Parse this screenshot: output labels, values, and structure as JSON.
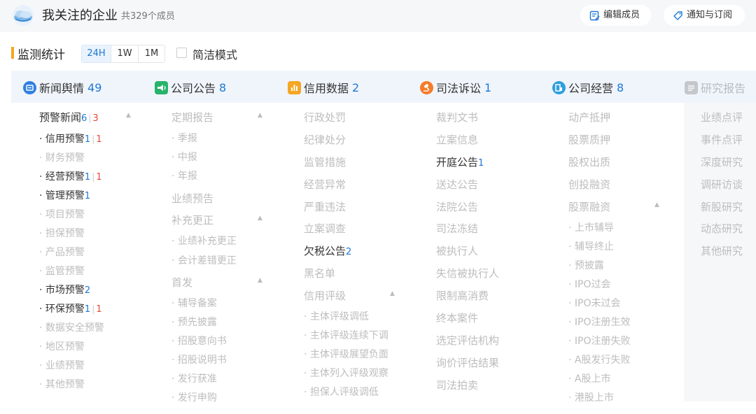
{
  "header": {
    "title": "我关注的企业",
    "member_count": "共329个成员",
    "edit_button": "编辑成员",
    "notify_button": "通知与订阅"
  },
  "monitor": {
    "title": "监测统计",
    "ranges": [
      "24H",
      "1W",
      "1M"
    ],
    "active_range": "24H",
    "simple_mode_label": "简洁模式",
    "simple_mode_checked": false
  },
  "tabs": [
    {
      "label": "新闻舆情",
      "count": "49",
      "icon": "news-icon",
      "color": "#2f7fe0"
    },
    {
      "label": "公司公告",
      "count": "8",
      "icon": "announcement-icon",
      "color": "#27b36b"
    },
    {
      "label": "信用数据",
      "count": "2",
      "icon": "bar-chart-icon",
      "color": "#f5a623"
    },
    {
      "label": "司法诉讼",
      "count": "1",
      "icon": "gavel-icon",
      "color": "#f57c2a"
    },
    {
      "label": "公司经营",
      "count": "8",
      "icon": "business-icon",
      "color": "#2f9fe0"
    },
    {
      "label": "研究报告",
      "count": "",
      "icon": "report-icon",
      "color": "#c4c7cc"
    }
  ],
  "columns": {
    "news": {
      "header": {
        "label": "预警新闻",
        "count_blue": "6",
        "count_red": "3"
      },
      "items": [
        {
          "label": "· 信用预警",
          "blue": "1",
          "red": "1",
          "active": true
        },
        {
          "label": "· 财务预警",
          "blue": "",
          "red": "",
          "active": false
        },
        {
          "label": "· 经营预警",
          "blue": "1",
          "red": "1",
          "active": true
        },
        {
          "label": "· 管理预警",
          "blue": "1",
          "red": "",
          "active": true
        },
        {
          "label": "· 项目预警",
          "blue": "",
          "red": "",
          "active": false
        },
        {
          "label": "· 担保预警",
          "blue": "",
          "red": "",
          "active": false
        },
        {
          "label": "· 产品预警",
          "blue": "",
          "red": "",
          "active": false
        },
        {
          "label": "· 监管预警",
          "blue": "",
          "red": "",
          "active": false
        },
        {
          "label": "· 市场预警",
          "blue": "2",
          "red": "",
          "active": true
        },
        {
          "label": "· 环保预警",
          "blue": "1",
          "red": "1",
          "active": true
        },
        {
          "label": "· 数据安全预警",
          "blue": "",
          "red": "",
          "active": false
        },
        {
          "label": "· 地区预警",
          "blue": "",
          "red": "",
          "active": false
        },
        {
          "label": "· 业绩预警",
          "blue": "",
          "red": "",
          "active": false
        },
        {
          "label": "· 其他预警",
          "blue": "",
          "red": "",
          "active": false
        }
      ]
    },
    "announcements": {
      "groups": [
        {
          "label": "定期报告",
          "items": [
            "· 季报",
            "· 中报",
            "· 年报"
          ]
        },
        {
          "label": "业绩预告",
          "items": []
        },
        {
          "label": "补充更正",
          "items": [
            "· 业绩补充更正",
            "· 会计差错更正"
          ]
        },
        {
          "label": "首发",
          "items": [
            "· 辅导备案",
            "· 预先披露",
            "· 招股意向书",
            "· 招股说明书",
            "· 发行获准",
            "· 发行申购"
          ]
        }
      ]
    },
    "credit": {
      "items": [
        {
          "label": "行政处罚",
          "count": "",
          "active": false
        },
        {
          "label": "纪律处分",
          "count": "",
          "active": false
        },
        {
          "label": "监管措施",
          "count": "",
          "active": false
        },
        {
          "label": "经营异常",
          "count": "",
          "active": false
        },
        {
          "label": "严重违法",
          "count": "",
          "active": false
        },
        {
          "label": "立案调查",
          "count": "",
          "active": false
        },
        {
          "label": "欠税公告",
          "count": "2",
          "active": true
        },
        {
          "label": "黑名单",
          "count": "",
          "active": false
        },
        {
          "label": "信用评级",
          "count": "",
          "active": false
        }
      ],
      "rating_items": [
        "· 主体评级调低",
        "· 主体评级连续下调",
        "· 主体评级展望负面",
        "· 主体列入评级观察",
        "· 担保人评级调低"
      ]
    },
    "judicial": {
      "items": [
        {
          "label": "裁判文书",
          "count": "",
          "active": false
        },
        {
          "label": "立案信息",
          "count": "",
          "active": false
        },
        {
          "label": "开庭公告",
          "count": "1",
          "active": true
        },
        {
          "label": "送达公告",
          "count": "",
          "active": false
        },
        {
          "label": "法院公告",
          "count": "",
          "active": false
        },
        {
          "label": "司法冻结",
          "count": "",
          "active": false
        },
        {
          "label": "被执行人",
          "count": "",
          "active": false
        },
        {
          "label": "失信被执行人",
          "count": "",
          "active": false
        },
        {
          "label": "限制高消费",
          "count": "",
          "active": false
        },
        {
          "label": "终本案件",
          "count": "",
          "active": false
        },
        {
          "label": "选定评估机构",
          "count": "",
          "active": false
        },
        {
          "label": "询价评估结果",
          "count": "",
          "active": false
        },
        {
          "label": "司法拍卖",
          "count": "",
          "active": false
        }
      ]
    },
    "operations": {
      "items": [
        "动产抵押",
        "股票质押",
        "股权出质",
        "创投融资",
        "股票融资"
      ],
      "financing_items": [
        "· 上市辅导",
        "· 辅导终止",
        "· 预披露",
        "· IPO过会",
        "· IPO未过会",
        "· IPO注册生效",
        "· IPO注册失败",
        "· A股发行失败",
        "· A股上市",
        "· 港股上市"
      ]
    },
    "research": {
      "items": [
        "业绩点评",
        "事件点评",
        "深度研究",
        "调研访谈",
        "新股研究",
        "动态研究",
        "其他研究"
      ]
    }
  }
}
